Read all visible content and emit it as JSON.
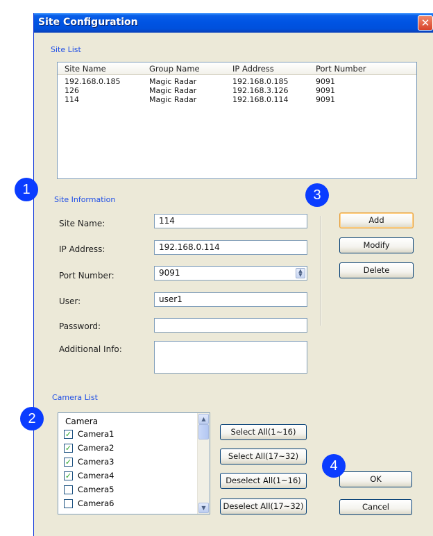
{
  "window": {
    "title": "Site Configuration",
    "close_glyph": "✕"
  },
  "site_list": {
    "legend": "Site List",
    "columns": [
      "Site Name",
      "Group Name",
      "IP Address",
      "Port Number"
    ],
    "rows": [
      [
        "192.168.0.185",
        "Magic Radar",
        "192.168.0.185",
        "9091"
      ],
      [
        "126",
        "Magic Radar",
        "192.168.3.126",
        "9091"
      ],
      [
        "114",
        "Magic Radar",
        "192.168.0.114",
        "9091"
      ]
    ]
  },
  "site_info": {
    "legend": "Site Information",
    "site_name_label": "Site Name:",
    "site_name_value": "114",
    "ip_label": "IP Address:",
    "ip_value": "192.168.0.114",
    "port_label": "Port Number:",
    "port_value": "9091",
    "user_label": "User:",
    "user_value": "user1",
    "password_label": "Password:",
    "password_value": "",
    "additional_label": "Additional Info:",
    "additional_value": ""
  },
  "site_buttons": {
    "add": "Add",
    "modify": "Modify",
    "delete": "Delete"
  },
  "camera_list": {
    "legend": "Camera List",
    "header": "Camera",
    "items": [
      {
        "label": "Camera1",
        "checked": true
      },
      {
        "label": "Camera2",
        "checked": true
      },
      {
        "label": "Camera3",
        "checked": true
      },
      {
        "label": "Camera4",
        "checked": true
      },
      {
        "label": "Camera5",
        "checked": false
      },
      {
        "label": "Camera6",
        "checked": false
      }
    ]
  },
  "camera_buttons": {
    "select_1_16": "Select All(1~16)",
    "select_17_32": "Select All(17~32)",
    "deselect_1_16": "Deselect All(1~16)",
    "deselect_17_32": "Deselect All(17~32)"
  },
  "dialog_buttons": {
    "ok": "OK",
    "cancel": "Cancel"
  },
  "badges": [
    "1",
    "2",
    "3",
    "4"
  ],
  "icons": {
    "check": "✓",
    "spin_up": "▲",
    "spin_down": "▼",
    "scroll_up": "▲",
    "scroll_down": "▼"
  },
  "colors": {
    "title_bar": "#0054e3",
    "badge": "#0a3cff",
    "legend_text": "#1f4ee6",
    "dialog_bg": "#ece9d8"
  }
}
